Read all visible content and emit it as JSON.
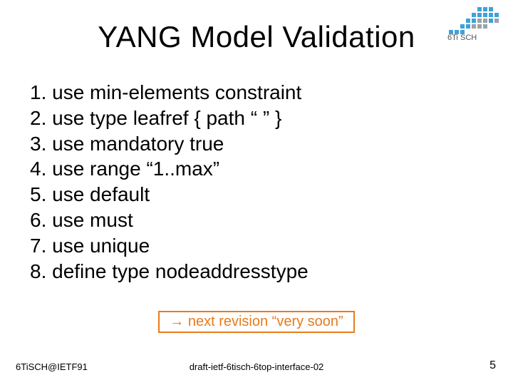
{
  "title": "YANG Model Validation",
  "list": {
    "items": [
      "1. use min-elements constraint",
      "2. use type leafref { path “ ” }",
      "3. use mandatory true",
      "4. use range “1..max”",
      "5. use default",
      "6. use must",
      "7. use unique",
      "8. define type nodeaddresstype"
    ]
  },
  "next_revision": "→ next revision “very soon”",
  "footer": {
    "left": "6TiSCH@IETF91",
    "center": "draft-ietf-6tisch-6top-interface-02",
    "page": "5"
  },
  "logo": {
    "label": "6TiSCH",
    "accent": "#3fa1d8"
  }
}
